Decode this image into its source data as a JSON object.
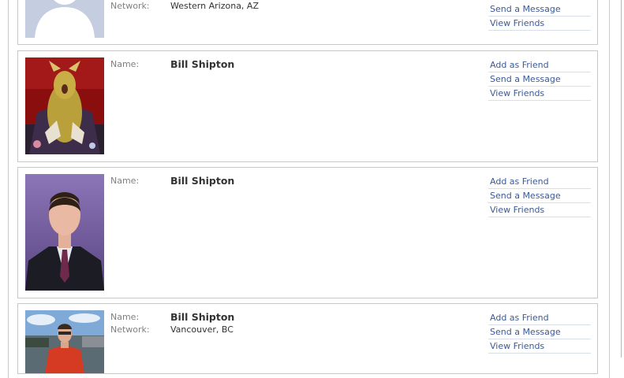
{
  "results": [
    {
      "photo": "default-silhouette",
      "fields": [
        {
          "label": "Network:",
          "value": "Western Arizona, AZ"
        }
      ],
      "actions": [
        "Send a Message",
        "View Friends"
      ]
    },
    {
      "photo": "costume-photo",
      "fields": [
        {
          "label": "Name:",
          "value": "Bill Shipton"
        }
      ],
      "actions": [
        "Add as Friend",
        "Send a Message",
        "View Friends"
      ]
    },
    {
      "photo": "suit-portrait",
      "fields": [
        {
          "label": "Name:",
          "value": "Bill Shipton"
        }
      ],
      "actions": [
        "Add as Friend",
        "Send a Message",
        "View Friends"
      ]
    },
    {
      "photo": "outdoor-photo",
      "fields": [
        {
          "label": "Name:",
          "value": "Bill Shipton"
        },
        {
          "label": "Network:",
          "value": "Vancouver, BC"
        }
      ],
      "actions": [
        "Add as Friend",
        "Send a Message",
        "View Friends"
      ]
    }
  ],
  "colors": {
    "link": "#3b5998",
    "label": "#808080",
    "border": "#c9c9c9",
    "divider": "#d8dfea"
  }
}
